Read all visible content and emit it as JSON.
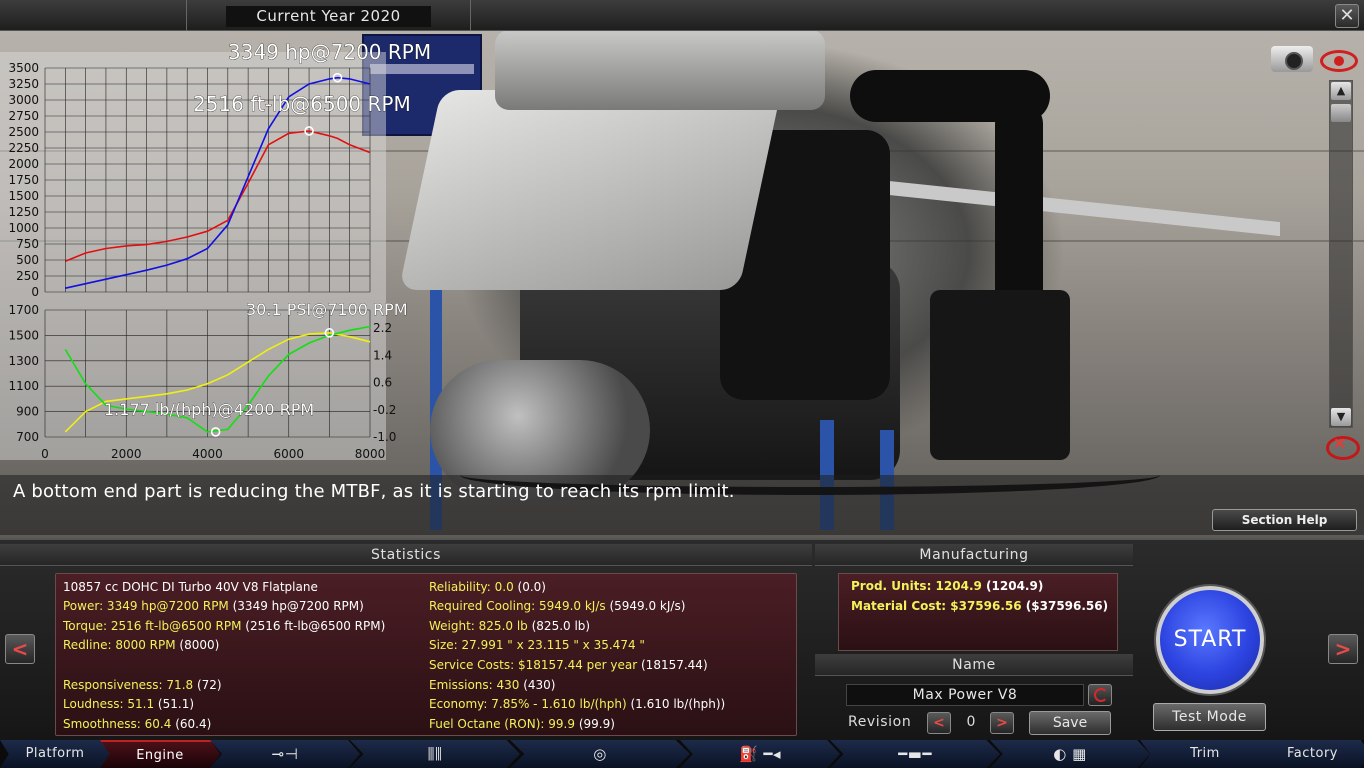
{
  "header": {
    "current_year": "Current Year 2020"
  },
  "chart_top": {
    "power_annotation": "3349 hp@7200 RPM",
    "torque_annotation": "2516 ft-lb@6500 RPM",
    "y_ticks": [
      "3500",
      "3250",
      "3000",
      "2750",
      "2500",
      "2250",
      "2000",
      "1750",
      "1500",
      "1250",
      "1000",
      "750",
      "500",
      "250",
      "0"
    ]
  },
  "chart_bottom": {
    "boost_annotation": "30.1 PSI@7100 RPM",
    "economy_annotation": "1.177 lb/(hph)@4200 RPM",
    "y_left_ticks": [
      "1700",
      "1500",
      "1300",
      "1100",
      "900",
      "700"
    ],
    "y_right_ticks": [
      "2.2",
      "1.4",
      "0.6",
      "-0.2",
      "-1.0"
    ],
    "x_ticks": [
      "0",
      "2000",
      "4000",
      "6000",
      "8000"
    ]
  },
  "chart_data": [
    {
      "type": "line",
      "x": [
        500,
        1000,
        1500,
        2000,
        2500,
        3000,
        3500,
        4000,
        4500,
        5000,
        5500,
        6000,
        6500,
        7000,
        7200,
        7500,
        8000
      ],
      "series": [
        {
          "name": "",
          "color": "#e01010",
          "values": [
            480,
            610,
            680,
            720,
            740,
            790,
            860,
            950,
            1120,
            1700,
            2300,
            2480,
            2516,
            2440,
            2400,
            2300,
            2180
          ]
        },
        {
          "name": "",
          "color": "#1010e0",
          "values": [
            60,
            130,
            200,
            270,
            340,
            420,
            520,
            680,
            1050,
            1800,
            2550,
            3050,
            3250,
            3330,
            3349,
            3330,
            3250
          ]
        }
      ],
      "xlim": [
        0,
        8000
      ],
      "ylim": [
        0,
        3500
      ],
      "grid": true
    },
    {
      "type": "line",
      "x": [
        500,
        1000,
        1500,
        2000,
        2500,
        3000,
        3500,
        4000,
        4500,
        5000,
        5500,
        6000,
        6500,
        7000,
        7500,
        8000
      ],
      "series": [
        {
          "name": "",
          "color": "#f0f010",
          "axis": "left",
          "values": [
            740,
            900,
            980,
            1000,
            1020,
            1040,
            1070,
            1120,
            1190,
            1290,
            1390,
            1470,
            1510,
            1520,
            1490,
            1450
          ]
        },
        {
          "name": "",
          "color": "#10e010",
          "axis": "left",
          "values": [
            1390,
            1120,
            950,
            920,
            900,
            880,
            850,
            740,
            760,
            950,
            1180,
            1350,
            1440,
            1500,
            1540,
            1570
          ]
        }
      ],
      "xlim": [
        0,
        8000
      ],
      "ylim": [
        700,
        1700
      ],
      "y2lim": [
        -1.0,
        2.2
      ],
      "grid": true
    }
  ],
  "message": {
    "text": "A bottom end part is reducing the MTBF, as it is starting to reach its rpm limit.",
    "help_button": "Section Help"
  },
  "statistics": {
    "heading": "Statistics",
    "left": [
      {
        "label": "10857 cc DOHC DI Turbo 40V V8 Flatplane",
        "prev": ""
      },
      {
        "label": "Power: 3349 hp@7200 RPM",
        "prev": " (3349 hp@7200 RPM)"
      },
      {
        "label": "Torque: 2516 ft-lb@6500 RPM",
        "prev": " (2516 ft-lb@6500 RPM)"
      },
      {
        "label": "Redline: 8000 RPM",
        "prev": " (8000)"
      },
      {
        "label": "Responsiveness: 71.8",
        "prev": " (72)"
      },
      {
        "label": "Loudness: 51.1",
        "prev": " (51.1)"
      },
      {
        "label": "Smoothness: 60.4",
        "prev": " (60.4)"
      }
    ],
    "right": [
      {
        "label": "Reliability: 0.0",
        "prev": " (0.0)"
      },
      {
        "label": "Required Cooling: 5949.0 kJ/s",
        "prev": " (5949.0 kJ/s)"
      },
      {
        "label": "Weight: 825.0 lb",
        "prev": " (825.0 lb)"
      },
      {
        "label": "Size: 27.991 \" x 23.115 \" x 35.474 \"",
        "prev": ""
      },
      {
        "label": "Service Costs: $18157.44 per year",
        "prev": " (18157.44)"
      },
      {
        "label": "Emissions: 430",
        "prev": " (430)"
      },
      {
        "label": "Economy: 7.85% - 1.610 lb/(hph)",
        "prev": " (1.610 lb/(hph))"
      },
      {
        "label": "Fuel Octane (RON): 99.9",
        "prev": " (99.9)"
      }
    ]
  },
  "manufacturing": {
    "heading": "Manufacturing",
    "prod_units": "Prod. Units: 1204.9",
    "prod_units_prev": " (1204.9)",
    "material_cost": "Material Cost: $37596.56",
    "material_cost_prev": " ($37596.56)"
  },
  "name_section": {
    "heading": "Name",
    "value": "Max Power V8",
    "revision_label": "Revision",
    "revision_value": "0",
    "save_label": "Save"
  },
  "actions": {
    "start": "START",
    "test_mode": "Test Mode"
  },
  "nav": {
    "left_arrow": "<",
    "right_arrow": ">",
    "tabs": [
      "Platform",
      "Engine",
      "Trim",
      "Factory"
    ]
  },
  "colors": {
    "accent_red": "#c02020",
    "start_blue": "#2c43e0",
    "stat_yellow": "#f2f25a"
  }
}
